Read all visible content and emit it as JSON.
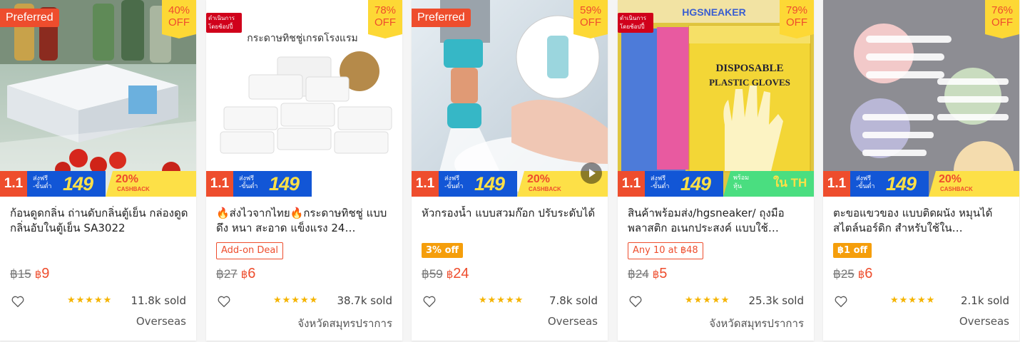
{
  "colors": {
    "brand": "#ee4d2d",
    "discount_bg": "#fdd835",
    "ship_blue": "#1256d6",
    "stars": "#f5b400"
  },
  "cards": [
    {
      "badge_type": "preferred",
      "badge_text": "Preferred",
      "discount_pct": "40%",
      "discount_off": "OFF",
      "promo": {
        "big": "1.1",
        "ship_label": "ส่งฟรี\n-ขั้นต่ำ",
        "ship_amount": "149",
        "right_type": "cashback",
        "right_big": "20%",
        "right_small": "CASHBACK"
      },
      "has_video": false,
      "name": "ก้อนดูดกลิ่น ถ่านดับกลิ่นตู้เย็น กล่องดูดกลิ่นอับในตู้เย็น SA3022",
      "tag": null,
      "price_old": "฿15",
      "price_new": "9",
      "rating_stars": "★★★★★",
      "sold": "11.8k sold",
      "location": "Overseas"
    },
    {
      "badge_type": "mall",
      "badge_text": "ดำเนินการ โดยช้อปปี้",
      "discount_pct": "78%",
      "discount_off": "OFF",
      "promo": {
        "big": "1.1",
        "ship_label": "ส่งฟรี\n-ขั้นต่ำ",
        "ship_amount": "149",
        "right_type": "none",
        "right_big": "",
        "right_small": ""
      },
      "has_video": false,
      "name": "🔥ส่งไวจากไทย🔥กระดาษทิชชู่ แบบดึง หนา สะอาด แข็งแรง 24…",
      "tag": {
        "style": "outline",
        "text": "Add-on Deal"
      },
      "price_old": "฿27",
      "price_new": "6",
      "rating_stars": "★★★★★",
      "sold": "38.7k sold",
      "location": "จังหวัดสมุทรปราการ",
      "image_text": "กระดาษทิชชู่เกรดโรงแรม"
    },
    {
      "badge_type": "preferred",
      "badge_text": "Preferred",
      "discount_pct": "59%",
      "discount_off": "OFF",
      "promo": {
        "big": "1.1",
        "ship_label": "ส่งฟรี\n-ขั้นต่ำ",
        "ship_amount": "149",
        "right_type": "cashback",
        "right_big": "20%",
        "right_small": "CASHBACK"
      },
      "has_video": true,
      "name": "หัวกรองน้ำ แบบสวมก๊อก ปรับระดับได้",
      "tag": {
        "style": "fill",
        "text": "3% off"
      },
      "price_old": "฿59",
      "price_new": "24",
      "rating_stars": "★★★★★",
      "sold": "7.8k sold",
      "location": "Overseas"
    },
    {
      "badge_type": "mall",
      "badge_text": "ดำเนินการ โดยช้อปปี้",
      "discount_pct": "79%",
      "discount_off": "OFF",
      "promo": {
        "big": "1.1",
        "ship_label": "ส่งฟรี\n-ขั้นต่ำ",
        "ship_amount": "149",
        "right_type": "local",
        "right_big": "ใน TH",
        "right_small": "พร้อม\nหุ้น"
      },
      "has_video": false,
      "name": "สินค้าพร้อมส่ง/hgsneaker/ ถุงมือพลาสติก อเนกประสงค์ แบบใช้…",
      "tag": {
        "style": "outline",
        "text": "Any 10 at ฿48"
      },
      "price_old": "฿24",
      "price_new": "5",
      "rating_stars": "★★★★★",
      "sold": "25.3k sold",
      "location": "จังหวัดสมุทรปราการ",
      "image_text": "DISPOSABLE PLASTIC GLOVES",
      "image_brand": "HGSNEAKER"
    },
    {
      "badge_type": "none",
      "badge_text": "",
      "discount_pct": "76%",
      "discount_off": "OFF",
      "promo": {
        "big": "1.1",
        "ship_label": "ส่งฟรี\n-ขั้นต่ำ",
        "ship_amount": "149",
        "right_type": "cashback",
        "right_big": "20%",
        "right_small": "CASHBACK"
      },
      "has_video": false,
      "name": "ตะขอแขวของ แบบติดผนัง หมุนได้สไตล์นอร์ดิก สำหรับใช้ใน…",
      "tag": {
        "style": "fill",
        "text": "฿1 off"
      },
      "price_old": "฿25",
      "price_new": "6",
      "rating_stars": "★★★★★",
      "sold": "2.1k sold",
      "location": "Overseas"
    }
  ]
}
